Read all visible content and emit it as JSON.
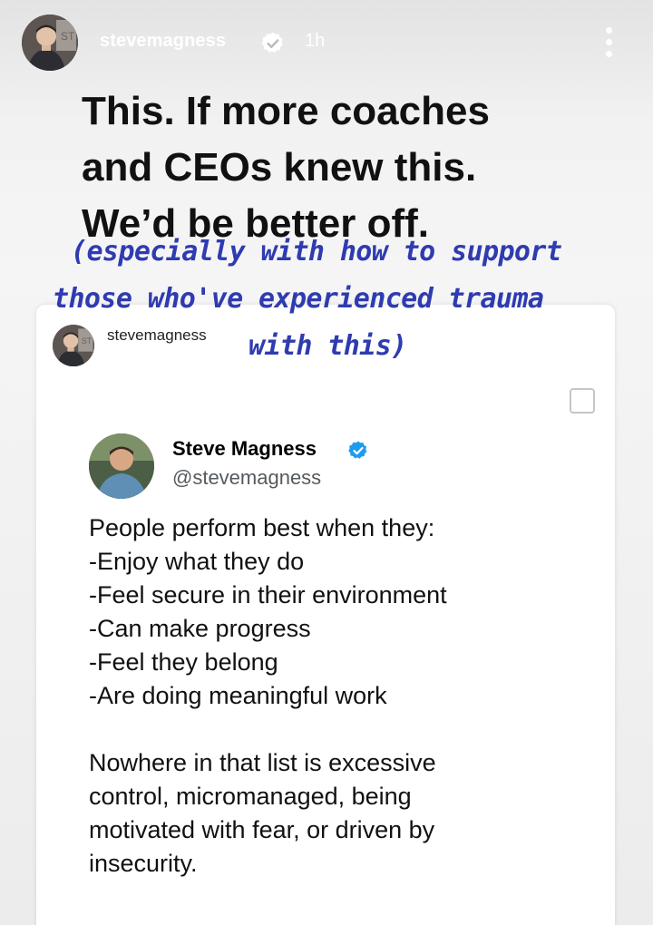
{
  "story": {
    "username": "stevemagness",
    "time": "1h",
    "icons": {
      "avatar": "profile-avatar",
      "verified": "verified-badge-icon",
      "more": "more-options-icon"
    },
    "caption_lines": [
      "This. If more coaches",
      "and CEOs knew this.",
      "We’d be better off."
    ]
  },
  "overlay_text_lines": [
    "(especially with how to support",
    "those who've experienced trauma",
    "with this)"
  ],
  "overlay_color": "#2f3bb0",
  "shared_post": {
    "username": "stevemagness",
    "tweet": {
      "name": "Steve Magness",
      "handle": "@stevemagness",
      "verified_color": "#1d9bf0",
      "lines": [
        "People perform best when they:",
        "-Enjoy what they do",
        "-Feel secure in their environment",
        "-Can make progress",
        "-Feel they belong",
        "-Are doing meaningful work"
      ],
      "paragraph2_lines": [
        "Nowhere in that list is excessive",
        "control, micromanaged, being",
        "motivated with fear, or driven by",
        "insecurity."
      ]
    }
  }
}
